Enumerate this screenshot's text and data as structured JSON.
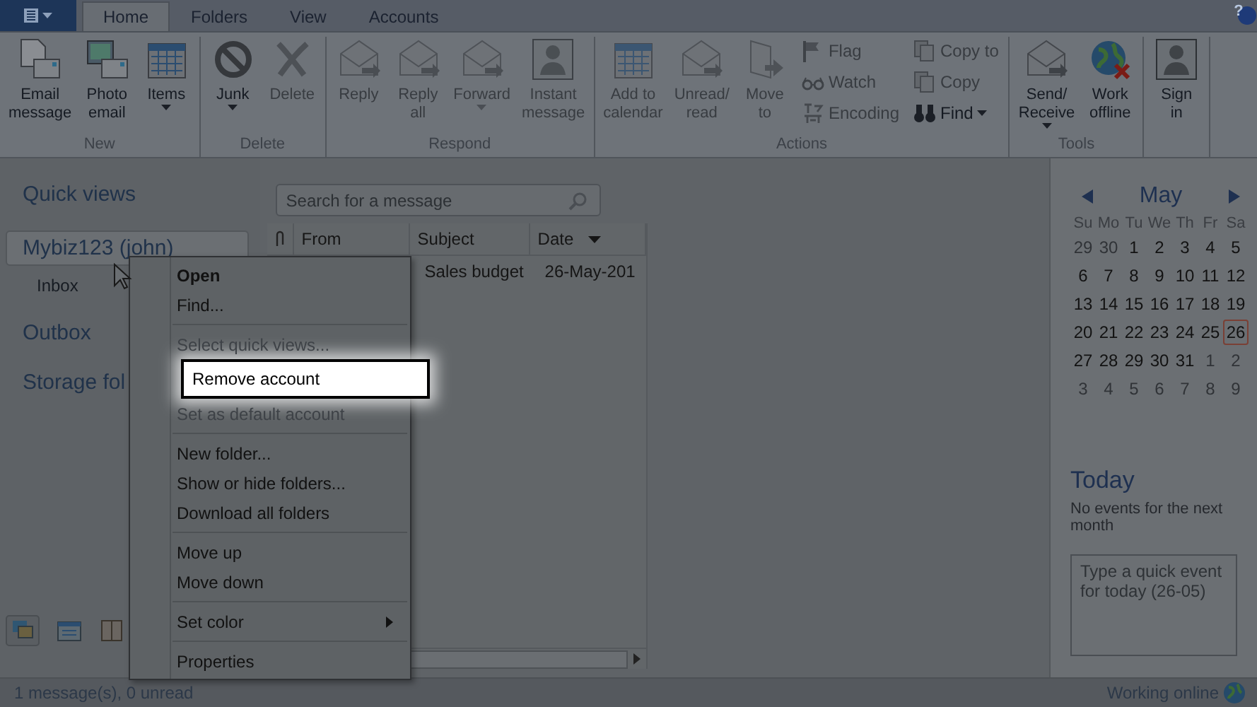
{
  "help": "?",
  "tabs": [
    {
      "label": "Home",
      "selected": true
    },
    {
      "label": "Folders",
      "selected": false
    },
    {
      "label": "View",
      "selected": false
    },
    {
      "label": "Accounts",
      "selected": false
    }
  ],
  "ribbon": [
    {
      "label": "New",
      "buttons": [
        {
          "kind": "large",
          "label": "Email\nmessage",
          "disabled": false,
          "dropdown": false
        },
        {
          "kind": "large",
          "label": "Photo\nemail",
          "disabled": false,
          "dropdown": false
        },
        {
          "kind": "large",
          "label": "Items",
          "disabled": false,
          "dropdown": true
        }
      ]
    },
    {
      "label": "Delete",
      "buttons": [
        {
          "kind": "large",
          "label": "Junk",
          "disabled": false,
          "dropdown": true
        },
        {
          "kind": "large",
          "label": "Delete",
          "disabled": true,
          "dropdown": false
        }
      ]
    },
    {
      "label": "Respond",
      "buttons": [
        {
          "kind": "large",
          "label": "Reply",
          "disabled": true,
          "dropdown": false
        },
        {
          "kind": "large",
          "label": "Reply\nall",
          "disabled": true,
          "dropdown": false
        },
        {
          "kind": "large",
          "label": "Forward",
          "disabled": true,
          "dropdown": true
        },
        {
          "kind": "large",
          "label": "Instant\nmessage",
          "disabled": true,
          "dropdown": false
        }
      ]
    },
    {
      "label": "Actions",
      "buttons": [
        {
          "kind": "large",
          "label": "Add to\ncalendar",
          "disabled": true,
          "dropdown": false
        },
        {
          "kind": "large",
          "label": "Unread/\nread",
          "disabled": true,
          "dropdown": false
        },
        {
          "kind": "large",
          "label": "Move\nto",
          "disabled": true,
          "dropdown": false
        },
        {
          "kind": "small",
          "label": "Flag",
          "disabled": true,
          "dropdown": false
        },
        {
          "kind": "small",
          "label": "Watch",
          "disabled": true,
          "dropdown": false
        },
        {
          "kind": "small",
          "label": "Encoding",
          "disabled": true,
          "dropdown": false
        },
        {
          "kind": "small",
          "label": "Copy to",
          "disabled": true,
          "dropdown": false
        },
        {
          "kind": "small",
          "label": "Copy",
          "disabled": true,
          "dropdown": false
        },
        {
          "kind": "small",
          "label": "Find",
          "disabled": false,
          "dropdown": true
        }
      ]
    },
    {
      "label": "Tools",
      "buttons": [
        {
          "kind": "large",
          "label": "Send/\nReceive",
          "disabled": false,
          "dropdown": true
        },
        {
          "kind": "large",
          "label": "Work\noffline",
          "disabled": false,
          "dropdown": false
        }
      ]
    },
    {
      "buttons": [
        {
          "kind": "large",
          "label": "Sign\nin",
          "disabled": false,
          "dropdown": false
        }
      ]
    }
  ],
  "nav": [
    {
      "kind": "heading",
      "label": "Quick views",
      "selected": false
    },
    {
      "kind": "account",
      "label": "Mybiz123 (john)",
      "selected": true
    },
    {
      "kind": "folder",
      "label": "Inbox",
      "selected": false
    },
    {
      "kind": "heading",
      "label": "Outbox",
      "selected": false
    },
    {
      "kind": "heading",
      "label": "Storage fol",
      "selected": false
    }
  ],
  "search": {
    "placeholder": "Search for a message"
  },
  "table": {
    "columns": [
      {
        "label": "From",
        "sorted": false
      },
      {
        "label": "Subject",
        "sorted": false
      },
      {
        "label": "Date",
        "sorted": true
      }
    ],
    "rows": [
      {
        "subject": "Sales budget",
        "date": "26-May-201"
      }
    ]
  },
  "context_menu": [
    {
      "kind": "item",
      "label": "Open",
      "default": true,
      "disabled": false,
      "selected": false,
      "submenu": false
    },
    {
      "kind": "item",
      "label": "Find...",
      "default": false,
      "disabled": false,
      "selected": false,
      "submenu": false
    },
    {
      "kind": "separator"
    },
    {
      "kind": "item",
      "label": "Select quick views...",
      "default": false,
      "disabled": true,
      "selected": false,
      "submenu": false
    },
    {
      "kind": "item",
      "label": "Remove account",
      "default": false,
      "disabled": false,
      "selected": true,
      "submenu": false
    },
    {
      "kind": "item",
      "label": "Set as default account",
      "default": false,
      "disabled": true,
      "selected": false,
      "submenu": false
    },
    {
      "kind": "separator"
    },
    {
      "kind": "item",
      "label": "New folder...",
      "default": false,
      "disabled": false,
      "selected": false,
      "submenu": false
    },
    {
      "kind": "item",
      "label": "Show or hide folders...",
      "default": false,
      "disabled": false,
      "selected": false,
      "submenu": false
    },
    {
      "kind": "item",
      "label": "Download all folders",
      "default": false,
      "disabled": false,
      "selected": false,
      "submenu": false
    },
    {
      "kind": "separator"
    },
    {
      "kind": "item",
      "label": "Move up",
      "default": false,
      "disabled": false,
      "selected": false,
      "submenu": false
    },
    {
      "kind": "item",
      "label": "Move down",
      "default": false,
      "disabled": false,
      "selected": false,
      "submenu": false
    },
    {
      "kind": "separator"
    },
    {
      "kind": "item",
      "label": "Set color",
      "default": false,
      "disabled": false,
      "selected": false,
      "submenu": true
    },
    {
      "kind": "separator"
    },
    {
      "kind": "item",
      "label": "Properties",
      "default": false,
      "disabled": false,
      "selected": false,
      "submenu": false
    }
  ],
  "calendar": {
    "month": "May",
    "weekdays": [
      "Su",
      "Mo",
      "Tu",
      "We",
      "Th",
      "Fr",
      "Sa"
    ],
    "days": [
      {
        "label": "29",
        "muted": true,
        "selected": false
      },
      {
        "label": "30",
        "muted": true,
        "selected": false
      },
      {
        "label": "1",
        "muted": false,
        "selected": false
      },
      {
        "label": "2",
        "muted": false,
        "selected": false
      },
      {
        "label": "3",
        "muted": false,
        "selected": false
      },
      {
        "label": "4",
        "muted": false,
        "selected": false
      },
      {
        "label": "5",
        "muted": false,
        "selected": false
      },
      {
        "label": "6",
        "muted": false,
        "selected": false
      },
      {
        "label": "7",
        "muted": false,
        "selected": false
      },
      {
        "label": "8",
        "muted": false,
        "selected": false
      },
      {
        "label": "9",
        "muted": false,
        "selected": false
      },
      {
        "label": "10",
        "muted": false,
        "selected": false
      },
      {
        "label": "11",
        "muted": false,
        "selected": false
      },
      {
        "label": "12",
        "muted": false,
        "selected": false
      },
      {
        "label": "13",
        "muted": false,
        "selected": false
      },
      {
        "label": "14",
        "muted": false,
        "selected": false
      },
      {
        "label": "15",
        "muted": false,
        "selected": false
      },
      {
        "label": "16",
        "muted": false,
        "selected": false
      },
      {
        "label": "17",
        "muted": false,
        "selected": false
      },
      {
        "label": "18",
        "muted": false,
        "selected": false
      },
      {
        "label": "19",
        "muted": false,
        "selected": false
      },
      {
        "label": "20",
        "muted": false,
        "selected": false
      },
      {
        "label": "21",
        "muted": false,
        "selected": false
      },
      {
        "label": "22",
        "muted": false,
        "selected": false
      },
      {
        "label": "23",
        "muted": false,
        "selected": false
      },
      {
        "label": "24",
        "muted": false,
        "selected": false
      },
      {
        "label": "25",
        "muted": false,
        "selected": false
      },
      {
        "label": "26",
        "muted": false,
        "selected": true
      },
      {
        "label": "27",
        "muted": false,
        "selected": false
      },
      {
        "label": "28",
        "muted": false,
        "selected": false
      },
      {
        "label": "29",
        "muted": false,
        "selected": false
      },
      {
        "label": "30",
        "muted": false,
        "selected": false
      },
      {
        "label": "31",
        "muted": false,
        "selected": false
      },
      {
        "label": "1",
        "muted": true,
        "selected": false
      },
      {
        "label": "2",
        "muted": true,
        "selected": false
      },
      {
        "label": "3",
        "muted": true,
        "selected": false
      },
      {
        "label": "4",
        "muted": true,
        "selected": false
      },
      {
        "label": "5",
        "muted": true,
        "selected": false
      },
      {
        "label": "6",
        "muted": true,
        "selected": false
      },
      {
        "label": "7",
        "muted": true,
        "selected": false
      },
      {
        "label": "8",
        "muted": true,
        "selected": false
      },
      {
        "label": "9",
        "muted": true,
        "selected": false
      }
    ]
  },
  "today": {
    "title": "Today",
    "message": "No events for the next month",
    "placeholder": "Type a quick event for today (26-05)"
  },
  "status_bar": {
    "left": "1 message(s), 0 unread",
    "right": "Working online"
  }
}
